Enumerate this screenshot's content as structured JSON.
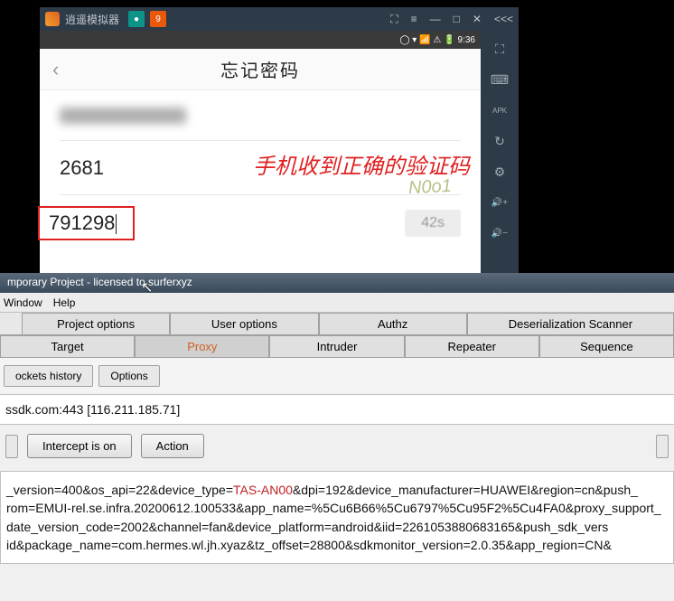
{
  "emulator": {
    "title": "逍遥模拟器",
    "win_buttons": {
      "focus": "⛶",
      "menu": "≡",
      "min": "—",
      "max": "□",
      "close": "✕",
      "more": "<<<"
    },
    "status": {
      "icons": "◯ ▾ 📶 ⚠ 🔋",
      "time": "9:36"
    },
    "app": {
      "back": "‹",
      "title": "忘记密码",
      "phone_code": "2681",
      "annotation": "手机收到正确的验证码",
      "captcha_faint": "N0o1",
      "verify_value": "791298",
      "countdown": "42s"
    },
    "sidebar_icons": {
      "expand": "⛶",
      "keyboard": "⌨",
      "apk": "APK",
      "rotate": "↻",
      "settings": "⚙",
      "vol_up": "🔊+",
      "vol_down": "🔊−"
    }
  },
  "burp": {
    "titlebar": "mporary Project - licensed to surferxyz",
    "menu": {
      "window": "Window",
      "help": "Help"
    },
    "tabs1": {
      "project_options": "Project options",
      "user_options": "User options",
      "authz": "Authz",
      "deser_scanner": "Deserialization Scanner"
    },
    "tabs2": {
      "target": "Target",
      "proxy": "Proxy",
      "intruder": "Intruder",
      "repeater": "Repeater",
      "sequencer": "Sequence"
    },
    "subtabs": {
      "history": "ockets history",
      "options": "Options"
    },
    "host_line": "ssdk.com:443  [116.211.185.71]",
    "buttons": {
      "intercept": "Intercept is on",
      "action": "Action"
    },
    "request": {
      "l1a": "_version=400&os_api=22&device_type=",
      "l1b": "TAS-AN00",
      "l1c": "&dpi=192&device_manufacturer=HUAWEI&region=cn&push_",
      "l2": "rom=EMUI-rel.se.infra.20200612.100533&app_name=%5Cu6B66%5Cu6797%5Cu95F2%5Cu4FA0&proxy_support_",
      "l3": "date_version_code=2002&channel=fan&device_platform=android&iid=2261053880683165&push_sdk_vers",
      "l4": "id&package_name=com.hermes.wl.jh.xyaz&tz_offset=28800&sdkmonitor_version=2.0.35&app_region=CN&"
    }
  }
}
